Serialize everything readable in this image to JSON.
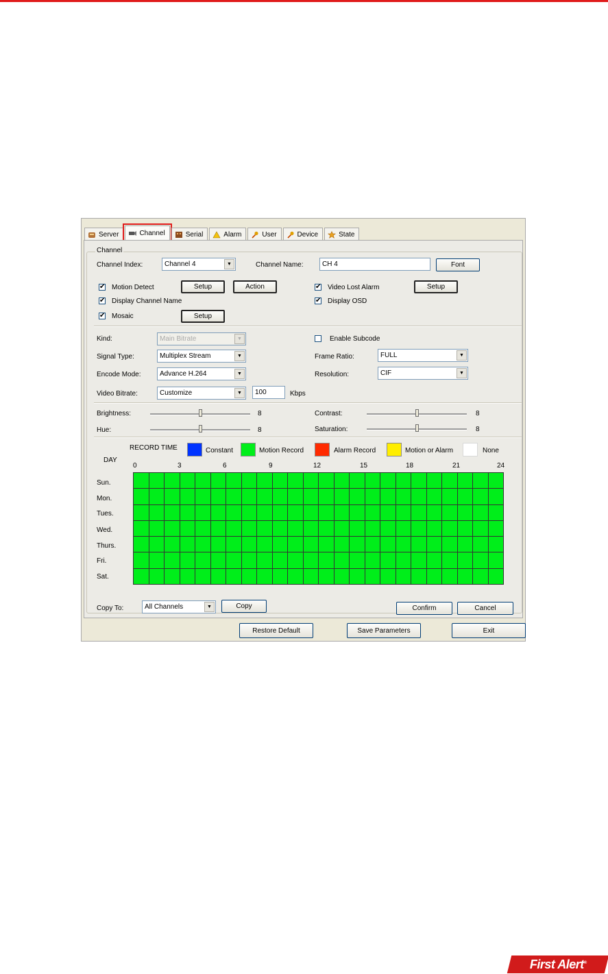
{
  "tabs": [
    {
      "label": "Server",
      "icon": "server-icon"
    },
    {
      "label": "Channel",
      "icon": "camera-icon"
    },
    {
      "label": "Serial",
      "icon": "serial-icon"
    },
    {
      "label": "Alarm",
      "icon": "alarm-icon"
    },
    {
      "label": "User",
      "icon": "user-key-icon"
    },
    {
      "label": "Device",
      "icon": "device-key-icon"
    },
    {
      "label": "State",
      "icon": "state-star-icon"
    }
  ],
  "channel": {
    "group_title": "Channel",
    "index_label": "Channel Index:",
    "index_value": "Channel 4",
    "name_label": "Channel Name:",
    "name_value": "CH 4",
    "font_button": "Font",
    "motion_detect": {
      "label": "Motion Detect",
      "checked": true,
      "setup_button": "Setup",
      "action_button": "Action"
    },
    "video_lost_alarm": {
      "label": "Video Lost Alarm",
      "checked": true,
      "setup_button": "Setup"
    },
    "display_channel_name": {
      "label": "Display Channel Name",
      "checked": true
    },
    "display_osd": {
      "label": "Display OSD",
      "checked": true
    },
    "mosaic": {
      "label": "Mosaic",
      "checked": true,
      "setup_button": "Setup"
    },
    "check_mark": "✔"
  },
  "encode": {
    "kind_label": "Kind:",
    "kind_value": "Main Bitrate",
    "enable_subcode_label": "Enable Subcode",
    "enable_subcode_checked": false,
    "signal_type_label": "Signal Type:",
    "signal_type_value": "Multiplex Stream",
    "frame_ratio_label": "Frame Ratio:",
    "frame_ratio_value": "FULL",
    "encode_mode_label": "Encode Mode:",
    "encode_mode_value": "Advance H.264",
    "resolution_label": "Resolution:",
    "resolution_value": "CIF",
    "video_bitrate_label": "Video Bitrate:",
    "video_bitrate_value": "Customize",
    "bitrate_number": "100",
    "bitrate_unit": "Kbps",
    "arrow": "▼"
  },
  "image": {
    "brightness": {
      "label": "Brightness:",
      "value": "8",
      "fraction": 0.5
    },
    "contrast": {
      "label": "Contrast:",
      "value": "8",
      "fraction": 0.5
    },
    "hue": {
      "label": "Hue:",
      "value": "8",
      "fraction": 0.5
    },
    "saturation": {
      "label": "Saturation:",
      "value": "8",
      "fraction": 0.5
    }
  },
  "record": {
    "title": "RECORD TIME",
    "day_label": "DAY",
    "legend": [
      {
        "label": "Constant",
        "color": "#0033ff"
      },
      {
        "label": "Motion Record",
        "color": "#00ee1a"
      },
      {
        "label": "Alarm Record",
        "color": "#ff2a00"
      },
      {
        "label": "Motion or Alarm",
        "color": "#ffee00"
      },
      {
        "label": "None",
        "color": "#ffffff"
      }
    ],
    "hours": [
      "0",
      "3",
      "6",
      "9",
      "12",
      "15",
      "18",
      "21",
      "24"
    ],
    "days": [
      "Sun.",
      "Mon.",
      "Tues.",
      "Wed.",
      "Thurs.",
      "Fri.",
      "Sat."
    ],
    "cell_color": "#00ee1a"
  },
  "footer": {
    "copy_to_label": "Copy To:",
    "copy_to_value": "All Channels",
    "copy_button": "Copy",
    "confirm_button": "Confirm",
    "cancel_button": "Cancel",
    "restore_default_button": "Restore Default",
    "save_parameters_button": "Save Parameters",
    "exit_button": "Exit"
  },
  "brand": {
    "name": "First Alert",
    "mark": "®",
    "color": "#d11b1b"
  }
}
